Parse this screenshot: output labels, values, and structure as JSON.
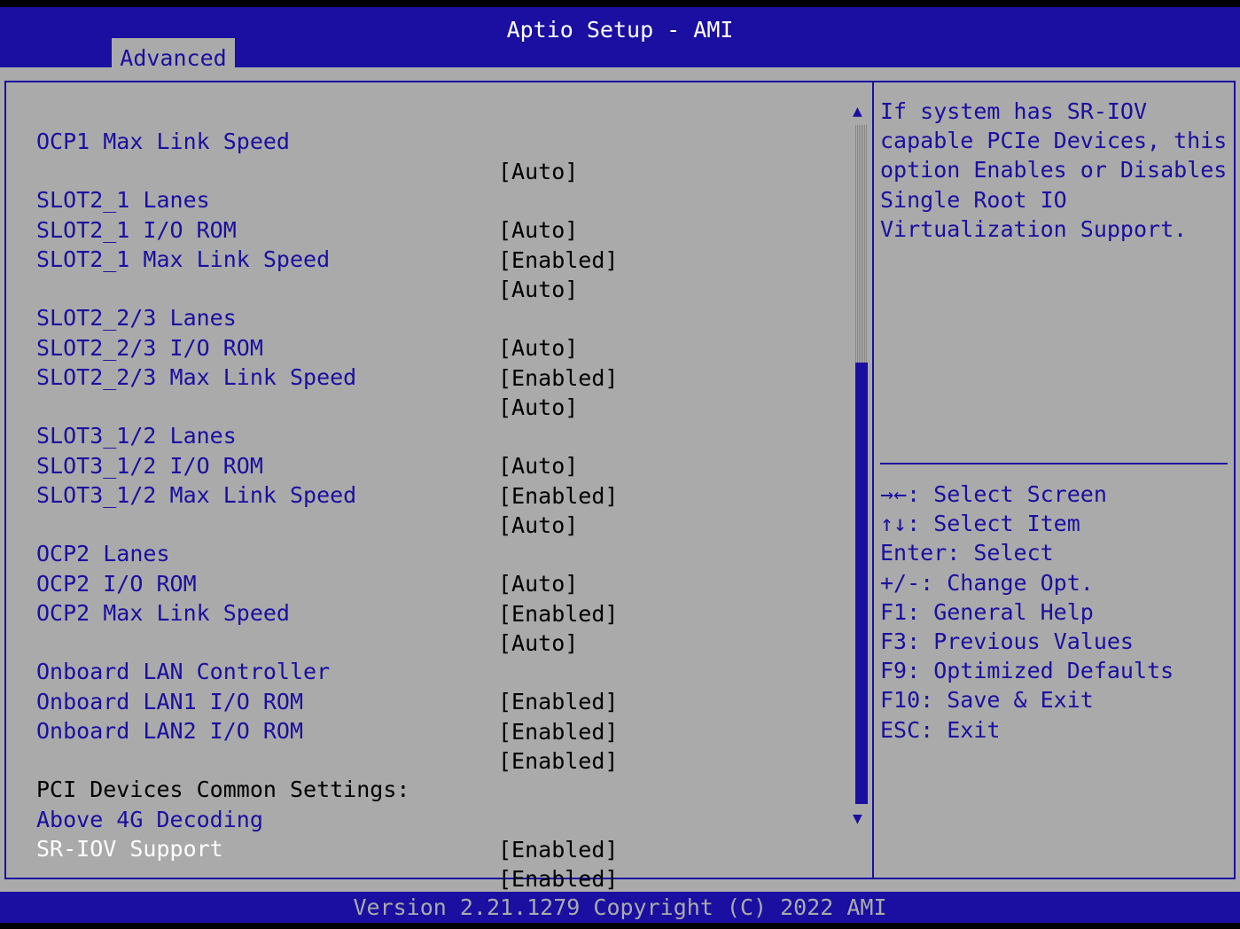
{
  "app": {
    "title": "Aptio Setup - AMI"
  },
  "tabs": [
    {
      "label": "Advanced"
    }
  ],
  "settings": [
    {
      "label": "OCP1 Max Link Speed",
      "value": "[Auto]"
    },
    {
      "label": "SLOT2_1 Lanes",
      "value": "[Auto]"
    },
    {
      "label": "SLOT2_1 I/O ROM",
      "value": "[Enabled]"
    },
    {
      "label": "SLOT2_1 Max Link Speed",
      "value": "[Auto]"
    },
    {
      "label": "SLOT2_2/3 Lanes",
      "value": "[Auto]"
    },
    {
      "label": "SLOT2_2/3 I/O ROM",
      "value": "[Enabled]"
    },
    {
      "label": "SLOT2_2/3 Max Link Speed",
      "value": "[Auto]"
    },
    {
      "label": "SLOT3_1/2 Lanes",
      "value": "[Auto]"
    },
    {
      "label": "SLOT3_1/2 I/O ROM",
      "value": "[Enabled]"
    },
    {
      "label": "SLOT3_1/2 Max Link Speed",
      "value": "[Auto]"
    },
    {
      "label": "OCP2 Lanes",
      "value": "[Auto]"
    },
    {
      "label": "OCP2 I/O ROM",
      "value": "[Enabled]"
    },
    {
      "label": "OCP2 Max Link Speed",
      "value": "[Auto]"
    },
    {
      "label": "Onboard LAN Controller",
      "value": "[Enabled]"
    },
    {
      "label": "Onboard LAN1 I/O ROM",
      "value": "[Enabled]"
    },
    {
      "label": "Onboard LAN2 I/O ROM",
      "value": "[Enabled]"
    },
    {
      "label": "PCI Devices Common Settings:"
    },
    {
      "label": "Above 4G Decoding",
      "value": "[Enabled]"
    },
    {
      "label": "SR-IOV Support",
      "value": "[Enabled]"
    }
  ],
  "help": {
    "lines": [
      "If system has SR-IOV",
      "capable PCIe Devices, this",
      "option Enables or Disables",
      "Single Root IO",
      "Virtualization Support."
    ]
  },
  "keys": [
    "→←: Select Screen",
    "↑↓: Select Item",
    "Enter: Select",
    "+/-: Change Opt.",
    "F1: General Help",
    "F3: Previous Values",
    "F9: Optimized Defaults",
    "F10: Save & Exit",
    "ESC: Exit"
  ],
  "scroll": {
    "up_arrow": "▲",
    "down_arrow": "▼"
  },
  "footer": {
    "text": "Version 2.21.1279 Copyright (C) 2022 AMI"
  },
  "colors": {
    "bg": "#aaaaaa",
    "accent": "#1a0fa0",
    "highlight": "#ffffff"
  }
}
